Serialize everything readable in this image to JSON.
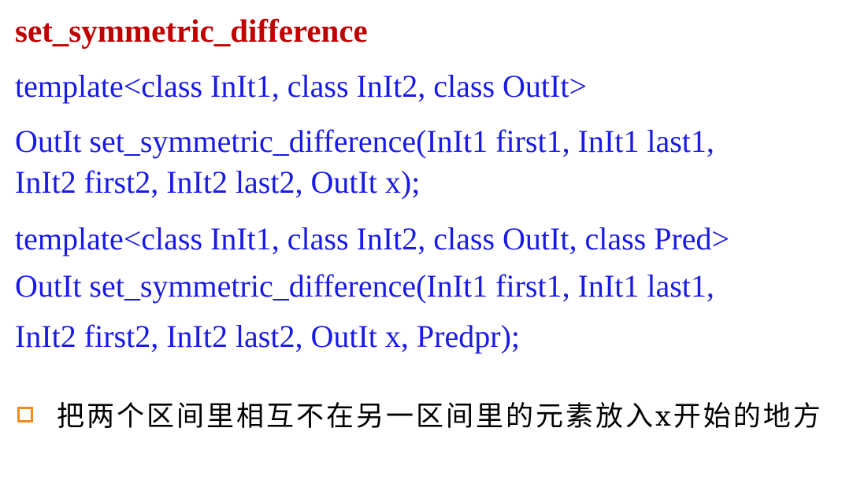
{
  "slide": {
    "title": "set_symmetric_difference",
    "code_lines": [
      "template<class InIt1, class InIt2, class OutIt>",
      "OutIt set_symmetric_difference(InIt1 first1, InIt1 last1,",
      "InIt2 first2, InIt2 last2, OutIt x);",
      "template<class InIt1, class InIt2, class OutIt, class Pred>",
      "OutIt set_symmetric_difference(InIt1 first1, InIt1 last1,",
      "InIt2 first2, InIt2 last2, OutIt x, Predpr);"
    ],
    "bullet_text": "把两个区间里相互不在另一区间里的元素放入x开始的地方",
    "colors": {
      "title": "#c00000",
      "code": "#1a1ae6",
      "bullet": "#f08c1e",
      "text": "#000000"
    }
  }
}
